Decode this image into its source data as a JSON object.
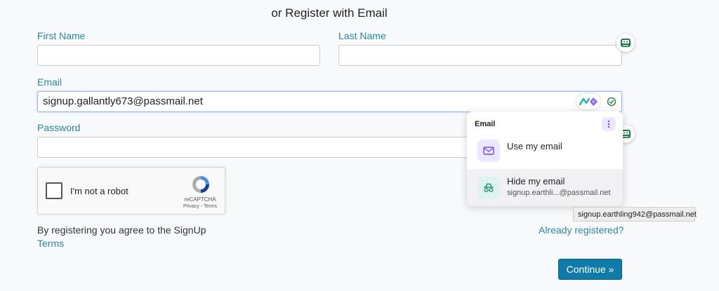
{
  "heading": "or Register with Email",
  "fields": {
    "first_name_label": "First Name",
    "last_name_label": "Last Name",
    "email_label": "Email",
    "email_value": "signup.gallantly673@passmail.net",
    "password_label": "Password"
  },
  "recaptcha": {
    "label": "I'm not a robot",
    "brand": "reCAPTCHA",
    "links": "Privacy - Terms"
  },
  "terms": {
    "text": "By registering you agree to the SignUp",
    "link": "Terms"
  },
  "already_registered": "Already registered?",
  "continue_label": "Continue »",
  "popup": {
    "title": "Email",
    "use_label": "Use my email",
    "hide_label": "Hide my email",
    "hide_preview": "signup.earthli...@passmail.net"
  },
  "tooltip": "signup.earthling942@passmail.net",
  "colors": {
    "label": "#2a86a3",
    "button": "#0e7ba8",
    "popup_accent": "#6d4aff",
    "hide_accent": "#1f8f7a"
  },
  "icons": {
    "side_button": "robot-icon",
    "email_logo": "extension-logo-icon",
    "email_valid": "check-circle-icon",
    "popup_menu": "kebab-menu-icon",
    "use_email": "envelope-icon",
    "hide_email": "incognito-icon",
    "recaptcha": "recaptcha-logo-icon"
  }
}
